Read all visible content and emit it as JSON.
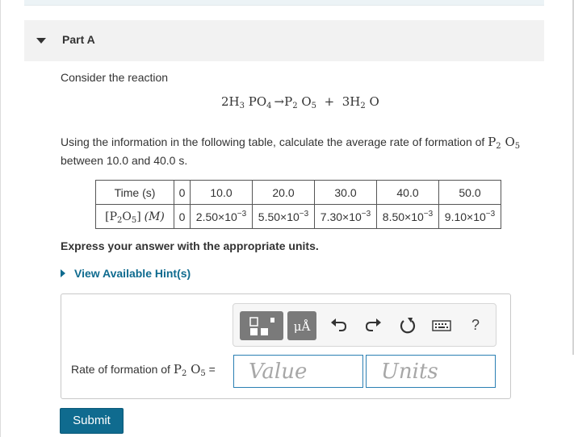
{
  "part": {
    "title": "Part A"
  },
  "problem": {
    "intro": "Consider the reaction",
    "question_before": "Using the information in the following table, calculate the average rate of formation of",
    "question_after": "between 10.0 and 40.0",
    "question_unit": "s",
    "question_end": "."
  },
  "table": {
    "header": {
      "label": "Time (s)",
      "values": [
        "0",
        "10.0",
        "20.0",
        "30.0",
        "40.0",
        "50.0"
      ]
    },
    "row": {
      "label_unit": "(M)",
      "values": [
        {
          "mantissa": "0",
          "exponent": ""
        },
        {
          "mantissa": "2.50×10",
          "exponent": "−3"
        },
        {
          "mantissa": "5.50×10",
          "exponent": "−3"
        },
        {
          "mantissa": "7.30×10",
          "exponent": "−3"
        },
        {
          "mantissa": "8.50×10",
          "exponent": "−3"
        },
        {
          "mantissa": "9.10×10",
          "exponent": "−3"
        }
      ]
    }
  },
  "instructions": {
    "express": "Express your answer with the appropriate units."
  },
  "hints": {
    "label": "View Available Hint(s)"
  },
  "answer": {
    "label_before": "Rate of formation of",
    "label_after": "=",
    "toolbar": {
      "units_label": "μÅ",
      "help_label": "?"
    },
    "value_placeholder": "Value",
    "units_placeholder": "Units"
  },
  "submit": {
    "label": "Submit"
  },
  "icons": [
    "caret-down-icon",
    "templates-icon",
    "units-icon",
    "undo-icon",
    "redo-icon",
    "reset-icon",
    "keyboard-icon",
    "help-icon",
    "caret-right-icon"
  ],
  "colors": {
    "accent": "#0f6b8f",
    "input_border": "#2a7fb3",
    "header_bg": "#f2f2f2",
    "toolbar_button": "#7a7a7a"
  }
}
